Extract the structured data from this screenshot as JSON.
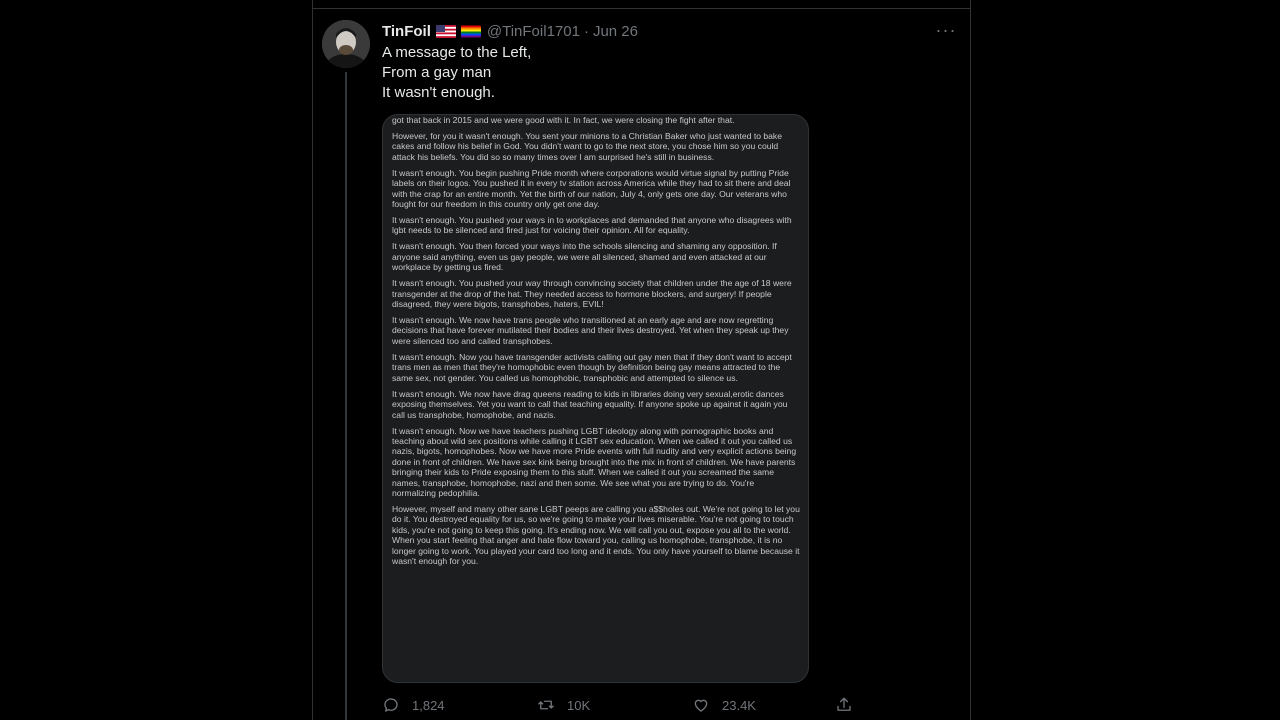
{
  "tweet": {
    "display_name": "TinFoil",
    "handle": "@TinFoil1701",
    "separator": "·",
    "date": "Jun 26",
    "badges": [
      "us-flag-icon",
      "rainbow-flag-icon"
    ],
    "text_lines": [
      "A message to the Left,",
      "From a gay man",
      "It wasn't enough."
    ],
    "more_label": "···"
  },
  "media": {
    "paragraphs": [
      "got that back in 2015 and we were good with it. In fact, we were closing the fight after that.",
      "However, for you it wasn't enough. You sent your minions to a Christian Baker who just wanted to bake cakes and follow his belief in God. You didn't want to go to the next store, you chose him so you could attack his beliefs. You did so so many times over I am surprised he's still in business.",
      "It wasn't enough. You begin pushing Pride month where corporations would virtue signal by putting Pride labels on their logos. You pushed it in every tv station across America while they had to sit there and deal with the crap for an entire month. Yet the birth of our nation, July 4, only gets one day. Our veterans who fought for our freedom in this country only get one day.",
      "It wasn't enough. You pushed your ways in to workplaces and demanded that anyone who disagrees with lgbt needs to be silenced and fired just for voicing their opinion. All for equality.",
      "It wasn't enough. You then forced your ways into the schools silencing and shaming any opposition. If anyone said anything, even us gay people, we were all silenced, shamed and even attacked at our workplace by getting us fired.",
      "It wasn't enough. You pushed your way through convincing society that children under the age of 18 were transgender at the drop of the hat. They needed access to hormone blockers, and surgery! If people disagreed, they were bigots, transphobes, haters, EVIL!",
      "It wasn't enough. We now have trans people who transitioned at an early age and are now regretting decisions that have forever mutilated their bodies and their lives destroyed. Yet when they speak up they were silenced too and called transphobes.",
      "It wasn't enough. Now you have transgender activists calling out gay men that if they don't want to accept trans men as men that they're homophobic even though by definition being gay means attracted to the same sex, not gender. You called us homophobic, transphobic and attempted to silence us.",
      "It wasn't enough. We now have drag queens reading to kids in libraries doing very sexual,erotic dances exposing themselves. Yet you want to call that teaching equality. If anyone spoke up against it again you call us transphobe, homophobe, and nazis.",
      "It wasn't enough. Now we have teachers pushing LGBT ideology along with pornographic books and teaching about wild sex positions while calling it LGBT sex education. When we called it out you called us nazis, bigots, homophobes. Now we have more Pride events with full nudity and very explicit actions being done in front of children. We have sex kink being brought into the mix in front of children. We have parents bringing their kids to Pride exposing them to this stuff. When we called it out you screamed the same names, transphobe, homophobe, nazi and then some. We see what you are trying to do. You're normalizing pedophilia.",
      "However, myself and many other sane LGBT peeps are calling you a$$holes out. We're not going to let you do it. You destroyed equality for us, so we're going to make your lives miserable. You're not going to touch kids, you're not going to keep this going. It's ending now. We will call you out, expose you all to the world. When you start feeling that anger and hate flow toward you, calling us homophobe, transphobe, it is no longer going to work. You played your card too long and it ends. You only have yourself to blame because it wasn't enough for you."
    ]
  },
  "actions": {
    "replies": "1,824",
    "retweets": "10K",
    "likes": "23.4K"
  },
  "colors": {
    "background": "#000000",
    "text": "#e7e9ea",
    "muted": "#71767b",
    "border": "#2f3336",
    "media_bg": "#1c1d1f"
  }
}
